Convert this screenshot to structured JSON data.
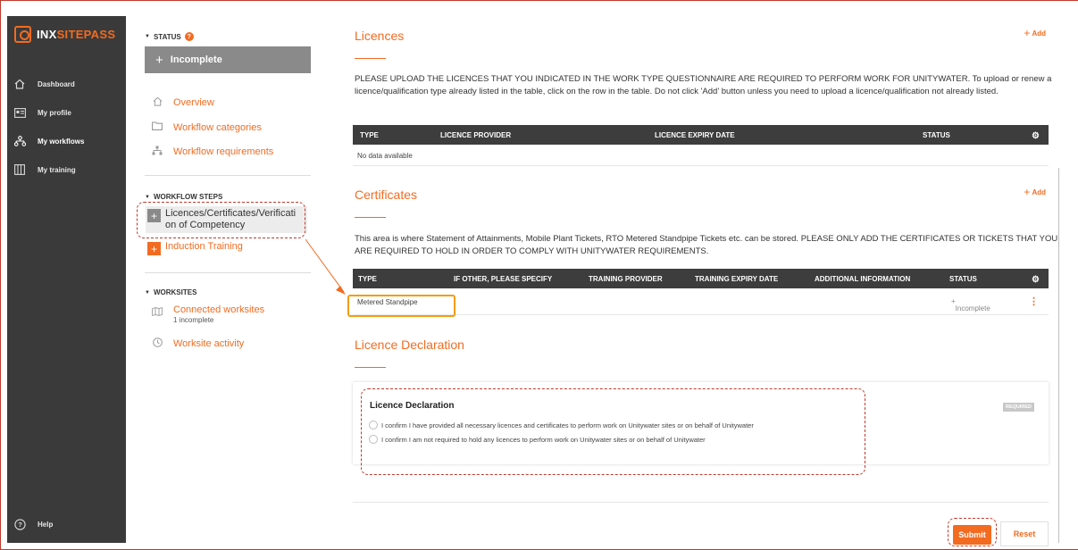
{
  "colors": {
    "accent": "#f26b21",
    "sidebar": "#3a3a3a",
    "annotation": "#c0392b"
  },
  "brand": {
    "logo_prefix": "INX",
    "logo_suffix": "SITEPASS"
  },
  "sidebar": {
    "items": [
      {
        "label": "Dashboard",
        "icon": "home-icon"
      },
      {
        "label": "My profile",
        "icon": "profile-card-icon"
      },
      {
        "label": "My workflows",
        "icon": "workflow-icon"
      },
      {
        "label": "My training",
        "icon": "book-icon"
      }
    ],
    "help_label": "Help"
  },
  "panel": {
    "status_header": "STATUS",
    "status_badge": "?",
    "status_value": "Incomplete",
    "links": [
      {
        "label": "Overview",
        "icon": "home-icon"
      },
      {
        "label": "Workflow categories",
        "icon": "folder-icon"
      },
      {
        "label": "Workflow requirements",
        "icon": "hierarchy-icon"
      }
    ],
    "steps_header": "WORKFLOW STEPS",
    "steps": [
      {
        "label_line1": "Licences/Certificates/Verificati",
        "label_line2": "on of Competency"
      },
      {
        "label_line1": "Induction Training"
      }
    ],
    "worksites_header": "WORKSITES",
    "worksite_links": [
      {
        "label": "Connected worksites",
        "sub": "1 incomplete"
      },
      {
        "label": "Worksite activity"
      }
    ]
  },
  "licences": {
    "title": "Licences",
    "add_label": "Add",
    "description": "PLEASE UPLOAD THE LICENCES THAT YOU INDICATED IN THE WORK TYPE QUESTIONNAIRE ARE REQUIRED TO PERFORM WORK FOR UNITYWATER. To upload or renew a licence/qualification type already listed in the table, click on the row in the table. Do not click 'Add' button unless you need to upload a licence/qualification not already listed.",
    "columns": [
      "TYPE",
      "LICENCE PROVIDER",
      "LICENCE EXPIRY DATE",
      "STATUS"
    ],
    "empty_text": "No data available"
  },
  "certificates": {
    "title": "Certificates",
    "add_label": "Add",
    "description": "This area is where Statement of Attainments, Mobile Plant Tickets, RTO Metered Standpipe Tickets etc. can be stored. PLEASE ONLY ADD THE CERTIFICATES OR TICKETS THAT YOU ARE REQUIRED TO HOLD IN ORDER TO COMPLY WITH UNITYWATER REQUIREMENTS.",
    "columns": [
      "TYPE",
      "IF OTHER, PLEASE SPECIFY",
      "TRAINING PROVIDER",
      "TRAINING EXPIRY DATE",
      "ADDITIONAL INFORMATION",
      "STATUS"
    ],
    "rows": [
      {
        "type": "Metered Standpipe",
        "status": "Incomplete"
      }
    ]
  },
  "declaration": {
    "title": "Licence Declaration",
    "card_title": "Licence Declaration",
    "required_label": "REQUIRED",
    "options": [
      "I confirm I have provided all necessary licences and certificates to perform work on Unitywater sites or on behalf of Unitywater",
      "I confirm I am not required to hold any licences to perform work on Unitywater sites or on behalf of Unitywater"
    ]
  },
  "actions": {
    "submit_label": "Submit",
    "reset_label": "Reset"
  }
}
